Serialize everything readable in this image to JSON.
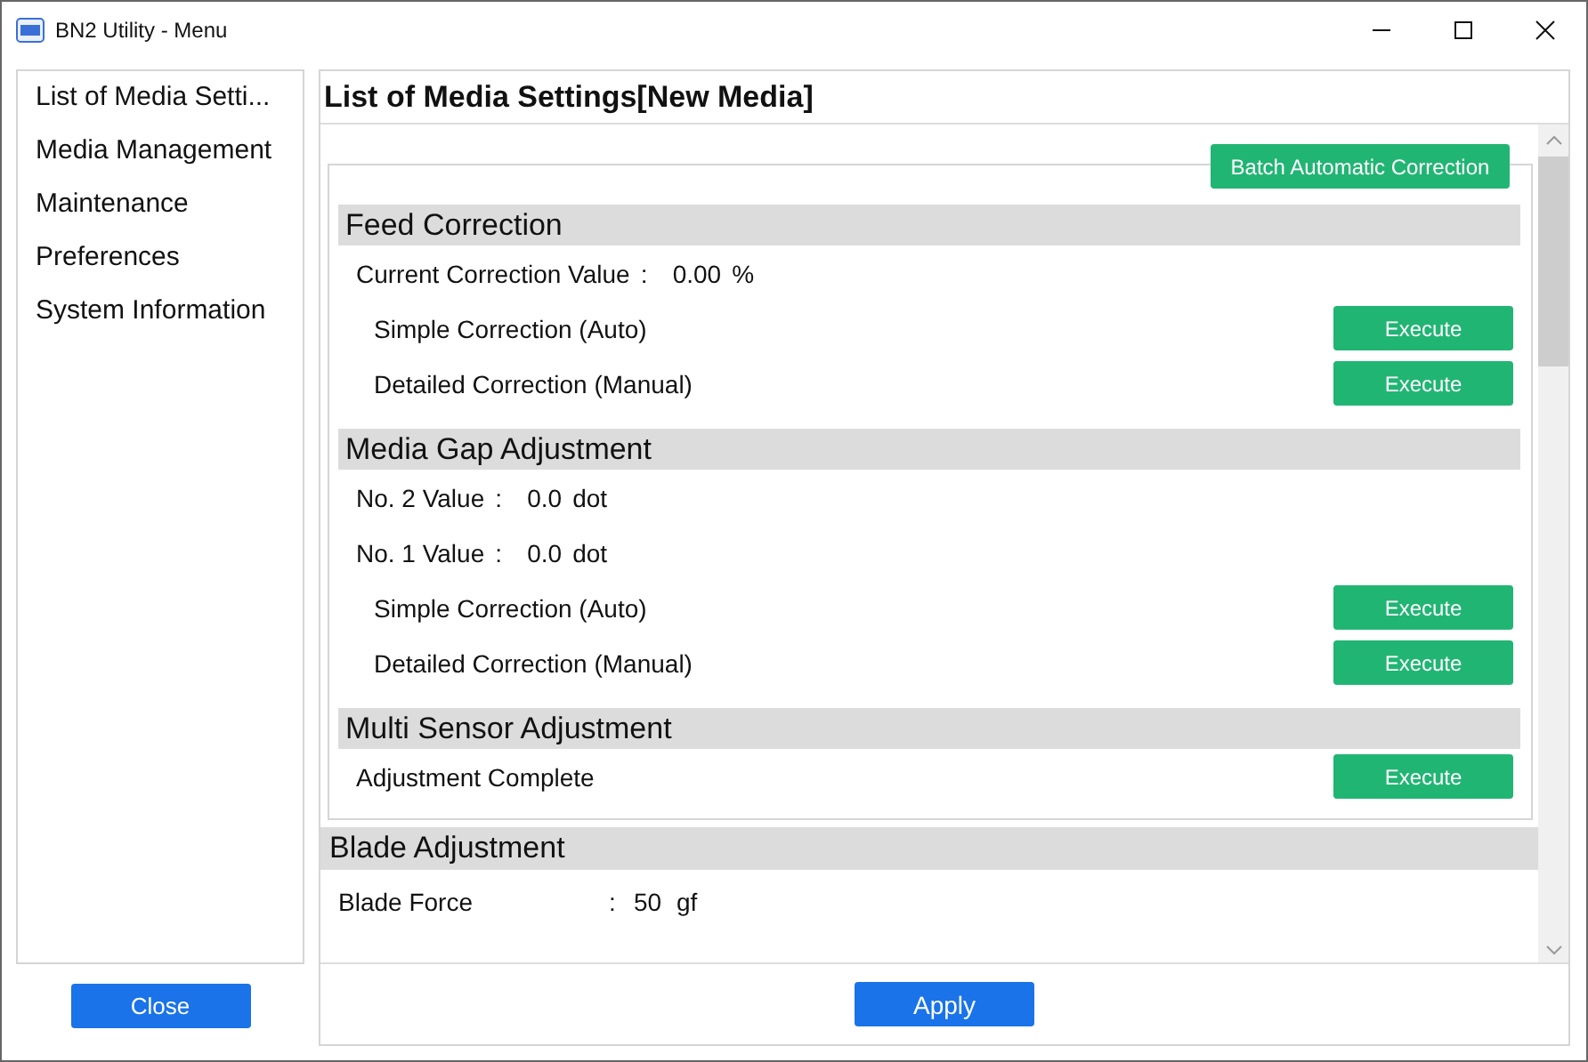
{
  "window": {
    "title": "BN2 Utility - Menu"
  },
  "sidebar": {
    "items": [
      {
        "label": "List of Media Setti...",
        "selected": false
      },
      {
        "label": "Media Management",
        "selected": false
      },
      {
        "label": "Maintenance",
        "selected": false
      },
      {
        "label": "Preferences",
        "selected": false
      },
      {
        "label": "System Information",
        "selected": false
      }
    ],
    "close_button": "Close"
  },
  "main": {
    "heading": "List of Media Settings[New Media]",
    "batch_button": "Batch Automatic Correction",
    "grouped_sections": [
      {
        "title": "Feed Correction",
        "rows": [
          {
            "kind": "value",
            "label": "Current Correction Value",
            "separator": ":",
            "value": "0.00",
            "unit": "%"
          },
          {
            "kind": "action",
            "label": "Simple Correction (Auto)",
            "button": "Execute"
          },
          {
            "kind": "action",
            "label": "Detailed Correction (Manual)",
            "button": "Execute"
          }
        ]
      },
      {
        "title": "Media Gap Adjustment",
        "rows": [
          {
            "kind": "value",
            "label": "No. 2 Value",
            "separator": ":",
            "value": "0.0",
            "unit": "dot"
          },
          {
            "kind": "value",
            "label": "No. 1 Value",
            "separator": ":",
            "value": "0.0",
            "unit": "dot"
          },
          {
            "kind": "action",
            "label": "Simple Correction (Auto)",
            "button": "Execute"
          },
          {
            "kind": "action",
            "label": "Detailed Correction (Manual)",
            "button": "Execute"
          }
        ]
      },
      {
        "title": "Multi Sensor Adjustment",
        "rows": [
          {
            "kind": "status_action",
            "label": "Adjustment Complete",
            "button": "Execute"
          }
        ]
      }
    ],
    "sections": [
      {
        "title": "Blade Adjustment",
        "rows": [
          {
            "kind": "wide_value",
            "label": "Blade Force",
            "separator": ":",
            "value": "50",
            "unit": "gf"
          }
        ]
      }
    ],
    "apply_button": "Apply"
  }
}
